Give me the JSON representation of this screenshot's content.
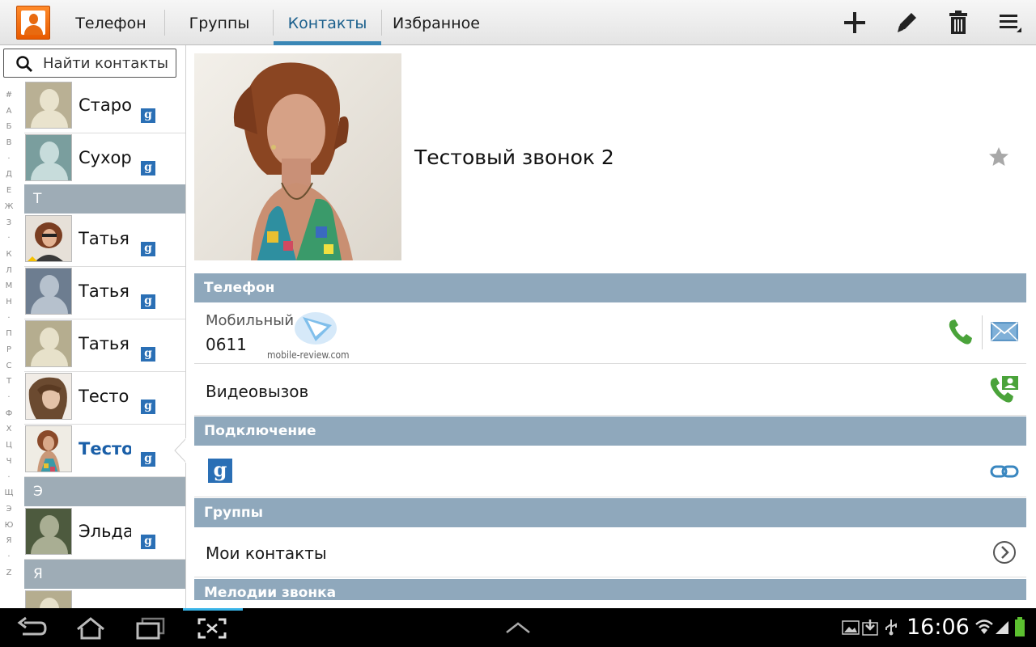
{
  "tabs": [
    {
      "label": "Телефон",
      "active": false
    },
    {
      "label": "Группы",
      "active": false
    },
    {
      "label": "Контакты",
      "active": true
    },
    {
      "label": "Избранное",
      "active": false
    }
  ],
  "actions": [
    "add-icon",
    "edit-icon",
    "delete-icon",
    "menu-icon"
  ],
  "search": {
    "placeholder": "Найти контакты"
  },
  "alphabet": [
    "#",
    "А",
    "Б",
    "В",
    "·",
    "Д",
    "Е",
    "Ж",
    "З",
    "·",
    "К",
    "Л",
    "М",
    "Н",
    "·",
    "П",
    "Р",
    "С",
    "Т",
    "·",
    "Ф",
    "Х",
    "Ц",
    "Ч",
    "·",
    "Щ",
    "Э",
    "Ю",
    "Я",
    "·",
    "Z"
  ],
  "list": {
    "rows": [
      {
        "name": "Старо",
        "avatar": "silhouette-olive"
      },
      {
        "name": "Сухору",
        "avatar": "silhouette-teal"
      },
      {
        "section": "Т"
      },
      {
        "name": "Татья",
        "avatar": "photo-1"
      },
      {
        "name": "Татья",
        "avatar": "silhouette-slate"
      },
      {
        "name": "Татья",
        "avatar": "silhouette-olive"
      },
      {
        "name": "Тесто",
        "avatar": "photo-2"
      },
      {
        "name": "Тесто",
        "avatar": "photo-3",
        "selected": true
      },
      {
        "section": "Э"
      },
      {
        "name": "Эльда",
        "avatar": "silhouette-dark"
      },
      {
        "section": "Я"
      }
    ]
  },
  "contact": {
    "name": "Тестовый звонок 2",
    "phone_header": "Телефон",
    "phone_type": "Мобильный",
    "phone_number": "0611",
    "video_call": "Видеовызов",
    "connection_header": "Подключение",
    "groups_header": "Группы",
    "group_name": "Мои контакты",
    "ringtone_header": "Мелодии звонка"
  },
  "watermark": "mobile-review.com",
  "status": {
    "time": "16:06"
  },
  "colors": {
    "accent": "#3a87b6",
    "section": "#8fa8bc",
    "call_green": "#4aa33a"
  }
}
